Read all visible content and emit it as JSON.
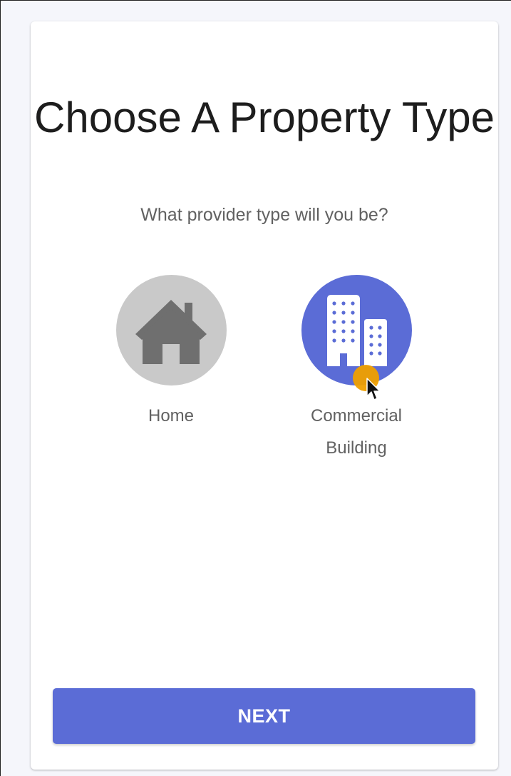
{
  "header": {
    "title": "Choose A Property Type",
    "subtitle": "What provider type will you be?"
  },
  "options": [
    {
      "label": "Home",
      "icon": "house-icon",
      "selected": false,
      "color": "#c9c9c9"
    },
    {
      "label": "Commercial\nBuilding",
      "icon": "building-icon",
      "selected": true,
      "color": "#5b6cd6"
    }
  ],
  "footer": {
    "next_label": "NEXT"
  },
  "colors": {
    "accent": "#5b6cd6",
    "cursor_highlight": "#f0a000",
    "unselected": "#c9c9c9"
  }
}
